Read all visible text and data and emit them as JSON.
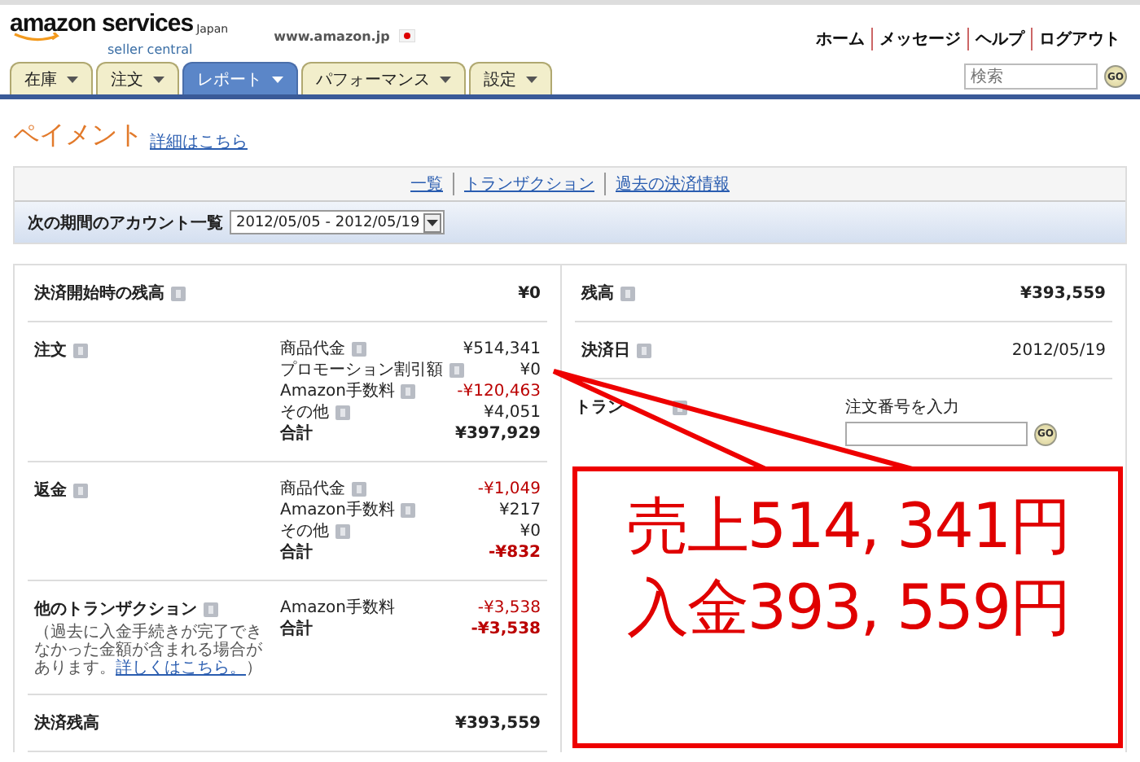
{
  "header": {
    "logo": {
      "brand": "amazon services",
      "region": "Japan",
      "product": "seller central"
    },
    "site": "www.amazon.jp",
    "top_links": [
      "ホーム",
      "メッセージ",
      "ヘルプ",
      "ログアウト"
    ],
    "search": {
      "placeholder": "検索",
      "button": "GO"
    }
  },
  "tabs": [
    {
      "label": "在庫",
      "selected": false
    },
    {
      "label": "注文",
      "selected": false
    },
    {
      "label": "レポート",
      "selected": true
    },
    {
      "label": "パフォーマンス",
      "selected": false
    },
    {
      "label": "設定",
      "selected": false
    }
  ],
  "page": {
    "title": "ペイメント",
    "link": "詳細はこちら"
  },
  "subnav": [
    {
      "label": "一覧"
    },
    {
      "label": "トランザクション"
    },
    {
      "label": "過去の決済情報"
    }
  ],
  "period": {
    "label": "次の期間のアカウント一覧",
    "value": "2012/05/05 - 2012/05/19"
  },
  "left_sections": [
    {
      "label": "決済開始時の残高",
      "help": true,
      "amount": "¥0"
    },
    {
      "label": "注文",
      "help": true,
      "lines": [
        {
          "label": "商品代金",
          "help": true,
          "amount": "¥514,341",
          "negative": false,
          "kind": "item"
        },
        {
          "label": "プロモーション割引額",
          "help": true,
          "amount": "¥0",
          "negative": false,
          "kind": "item"
        },
        {
          "label": "Amazon手数料",
          "help": true,
          "amount": "-¥120,463",
          "negative": true,
          "kind": "item"
        },
        {
          "label": "その他",
          "help": true,
          "amount": "¥4,051",
          "negative": false,
          "kind": "item"
        },
        {
          "label": "合計",
          "help": false,
          "amount": "¥397,929",
          "negative": false,
          "kind": "total"
        }
      ]
    },
    {
      "label": "返金",
      "help": true,
      "lines": [
        {
          "label": "商品代金",
          "help": true,
          "amount": "-¥1,049",
          "negative": true,
          "kind": "item"
        },
        {
          "label": "Amazon手数料",
          "help": true,
          "amount": "¥217",
          "negative": false,
          "kind": "item"
        },
        {
          "label": "その他",
          "help": true,
          "amount": "¥0",
          "negative": false,
          "kind": "item"
        },
        {
          "label": "合計",
          "help": false,
          "amount": "-¥832",
          "negative": true,
          "kind": "total"
        }
      ]
    },
    {
      "label": "他のトランザクション",
      "help": true,
      "note": "（過去に入金手続きが完了できなかった金額が含まれる場合があります。",
      "note_link": "詳しくはこちら。",
      "note_end": "）",
      "lines": [
        {
          "label": "Amazon手数料",
          "help": false,
          "amount": "-¥3,538",
          "negative": true,
          "kind": "item"
        },
        {
          "label": "合計",
          "help": false,
          "amount": "-¥3,538",
          "negative": true,
          "kind": "total"
        }
      ]
    },
    {
      "label": "決済残高",
      "help": false,
      "amount": "¥393,559"
    }
  ],
  "right_sections": [
    {
      "label": "残高",
      "help": true,
      "value": "¥393,559",
      "kind": "amount"
    },
    {
      "label": "決済日",
      "help": true,
      "value": "2012/05/19",
      "kind": "date"
    },
    {
      "label": "トラン",
      "help": true,
      "kind": "search",
      "field_label": "注文番号を入力",
      "button": "GO"
    }
  ],
  "callout": {
    "lines": [
      "売上514, 341円",
      "入金393, 559円"
    ]
  }
}
